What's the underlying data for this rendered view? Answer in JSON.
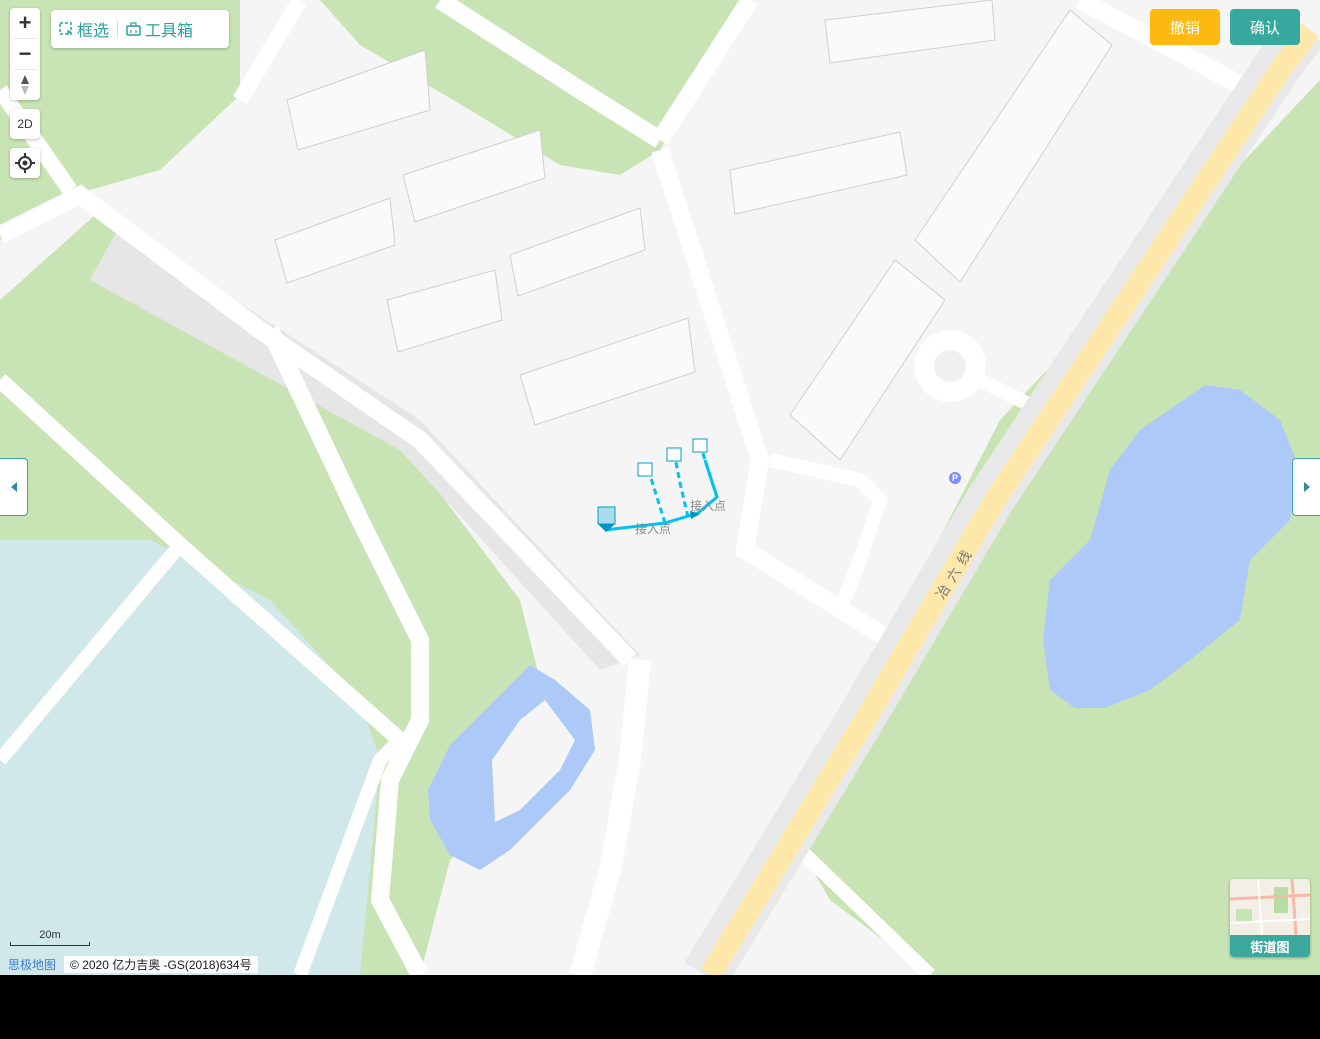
{
  "toolbar": {
    "select_label": "框选",
    "toolbox_label": "工具箱"
  },
  "zoom": {
    "in_symbol": "+",
    "out_symbol": "−",
    "view_2d_label": "2D"
  },
  "actions": {
    "undo_label": "撤销",
    "undo_color": "#fdb90f",
    "confirm_label": "确认",
    "confirm_color": "#36a89d"
  },
  "map": {
    "road_label": "冶六线",
    "access_point_label_1": "接入点",
    "access_point_label_2": "接入点",
    "parking_symbol": "P",
    "scale_label": "20m",
    "attribution_brand": "思极地图",
    "attribution_text": "© 2020 亿力吉奥 -GS(2018)634号",
    "colors": {
      "green_area": "#c8e4b4",
      "water": "#adc9f7",
      "water_light": "#cfe7ea",
      "main_road": "#fde7a9",
      "road_line": "#00c2ee"
    }
  },
  "streetview": {
    "label": "街道图"
  }
}
